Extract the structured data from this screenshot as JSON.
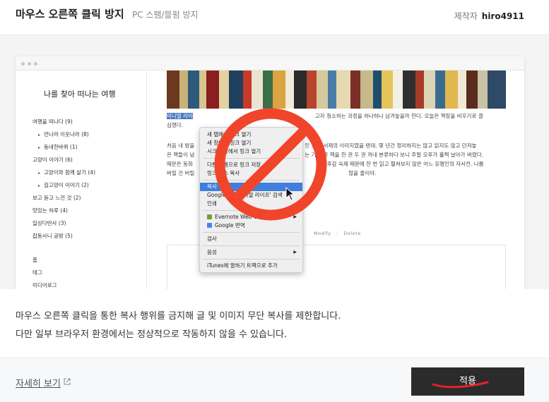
{
  "header": {
    "title": "마우스 오른쪽 클릭 방지",
    "subtitle": "PC 스팸/블펌 방지",
    "author_label": "제작자",
    "author_name": "hiro4911"
  },
  "preview": {
    "blog_title": "나를 찾아 떠나는 여행",
    "categories": [
      "여행을 떠나다 (9)",
      "먼나라 이웃나라 (8)",
      "동네한바퀴 (1)",
      "고양이 이야기 (6)",
      "고양이와 함께 살기 (4)",
      "길고양이 이야기 (2)",
      "보고 듣고 느낀 것 (2)",
      "맛있는 하루 (4)",
      "일상다반사 (3)",
      "잡동사니 공방 (5)",
      "홈",
      "태그",
      "미디어로그"
    ],
    "para1_highlight": "미니멀 라이",
    "para1_text": "고자 청소하는 과정을 하나하나 남겨놓을까 한다. 오늘은 책장을 비우기로 결",
    "para1_line2": "심했다.",
    "para2_line1a": "처음 내 방을",
    "para2_line1b": "인 오",
    "para2_line1c": "서재의 이미지였을 텐데. 몇 년간 정리하지는 않고 읽지도 않고 던져놓",
    "para2_line2a": "은 책들이 넘",
    "para2_line2b": "는 기",
    "para2_line2c": "로 책을 한 권 두 권 꺼내 분류하다 보니 주말 오후가 훌쩍 날아가 버렸다.",
    "para2_line3a": "때문은 동화",
    "para2_line3b": "진",
    "para2_line3c": "국후감 숙제 때문에 한 번 읽고 펼쳐보지 않은 어느 유명인의 자서전. 나름",
    "para2_line4a": "버릴 건 버릴",
    "para2_line4b": "많을 줄이야.",
    "modify": "Modify",
    "delete": "Delete",
    "context_menu": [
      "새 탭에서 링크 열기",
      "새 창에서 링크 열기",
      "시크릿 창에서 링크 열기",
      "다른 이름으로 링크 저장...",
      "링크 주소 복사",
      "복사",
      "Google에서 '미니멀 라이프' 검색",
      "인쇄",
      "Evernote Web Clipper",
      "Google 번역",
      "검사",
      "음성",
      "iTunes에 말하기 트랙으로 추가"
    ]
  },
  "description": {
    "line1": "마우스 오른쪽 클릭을 통한 복사 행위를 금지해 글 및 이미지 무단 복사를 제한합니다.",
    "line2": "다만 일부 브라우저 환경에서는 정상적으로 작동하지 않을 수 있습니다."
  },
  "footer": {
    "more_link": "자세히 보기",
    "apply_button": "적용"
  },
  "colors": {
    "ban_sign": "#f0452a",
    "apply_bg": "#2b2b2b",
    "annotation": "#e8202a",
    "menu_highlight": "#3f7fde"
  },
  "icons": [
    "external-link-icon",
    "prohibition-icon",
    "cursor-icon",
    "evernote-icon",
    "google-icon",
    "window-dots-icon"
  ]
}
